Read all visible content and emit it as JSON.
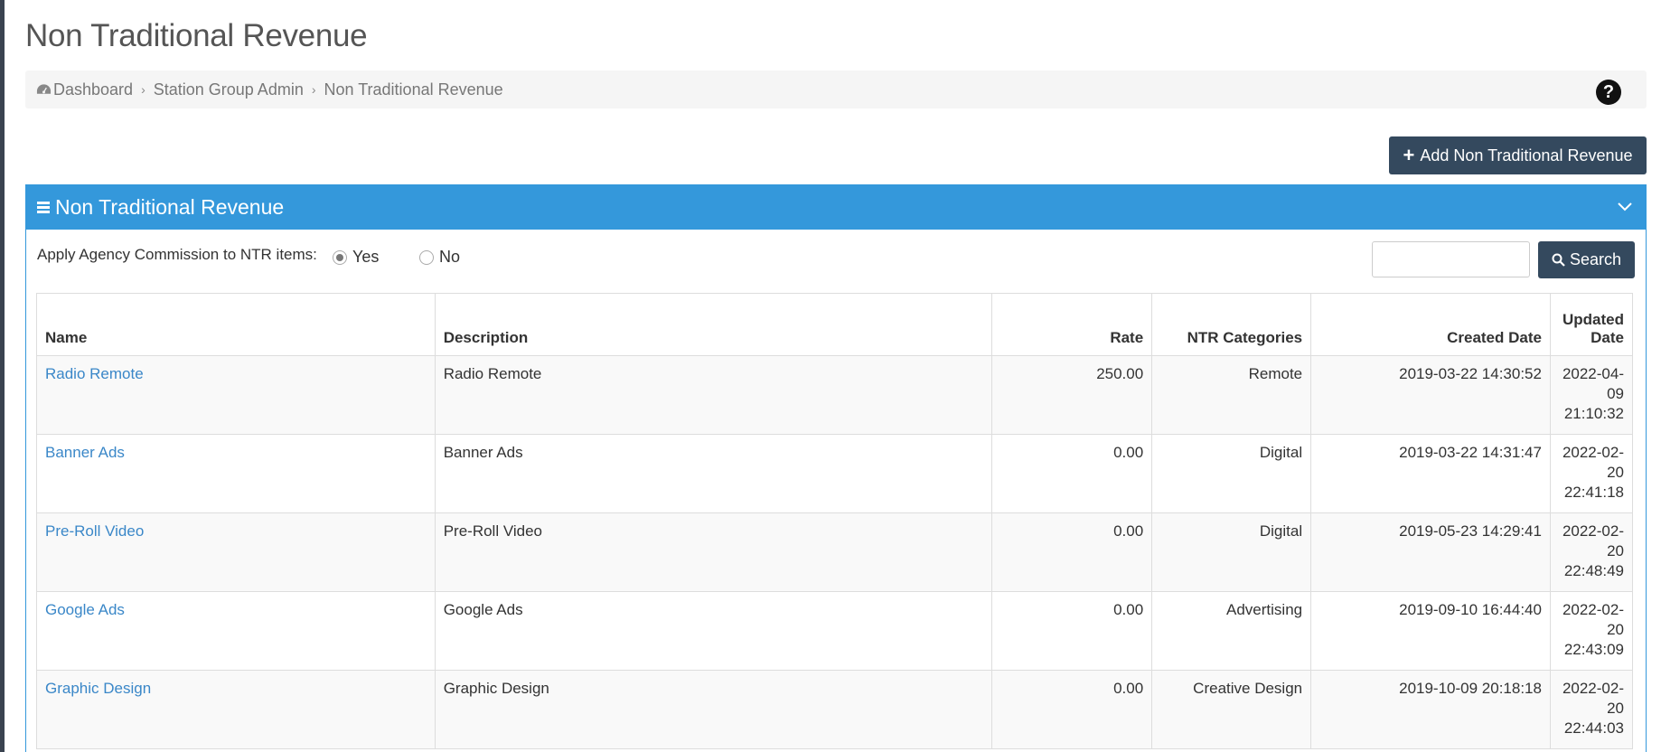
{
  "page": {
    "title": "Non Traditional Revenue"
  },
  "breadcrumb": {
    "items": [
      "Dashboard",
      "Station Group Admin",
      "Non Traditional Revenue"
    ]
  },
  "toolbar": {
    "add_label": "Add Non Traditional Revenue"
  },
  "panel": {
    "title": "Non Traditional Revenue",
    "commission_label": "Apply Agency Commission to NTR items:",
    "radio_yes": "Yes",
    "radio_no": "No",
    "selected": "Yes",
    "search_value": "",
    "search_label": "Search"
  },
  "table": {
    "headers": {
      "name": "Name",
      "description": "Description",
      "rate": "Rate",
      "categories": "NTR Categories",
      "created": "Created Date",
      "updated_1": "Updated",
      "updated_2": "Date"
    },
    "rows": [
      {
        "name": "Radio Remote",
        "description": "Radio Remote",
        "rate": "250.00",
        "category": "Remote",
        "created": "2019-03-22 14:30:52",
        "updated_a": "2022-04-",
        "updated_b": "09",
        "updated_c": "21:10:32"
      },
      {
        "name": "Banner Ads",
        "description": "Banner Ads",
        "rate": "0.00",
        "category": "Digital",
        "created": "2019-03-22 14:31:47",
        "updated_a": "2022-02-",
        "updated_b": "20",
        "updated_c": "22:41:18"
      },
      {
        "name": "Pre-Roll Video",
        "description": "Pre-Roll Video",
        "rate": "0.00",
        "category": "Digital",
        "created": "2019-05-23 14:29:41",
        "updated_a": "2022-02-",
        "updated_b": "20",
        "updated_c": "22:48:49"
      },
      {
        "name": "Google Ads",
        "description": "Google Ads",
        "rate": "0.00",
        "category": "Advertising",
        "created": "2019-09-10 16:44:40",
        "updated_a": "2022-02-",
        "updated_b": "20",
        "updated_c": "22:43:09"
      },
      {
        "name": "Graphic Design",
        "description": "Graphic Design",
        "rate": "0.00",
        "category": "Creative Design",
        "created": "2019-10-09 20:18:18",
        "updated_a": "2022-02-",
        "updated_b": "20",
        "updated_c": "22:44:03"
      }
    ]
  },
  "colors": {
    "accent": "#3498db",
    "dark_button": "#34495e",
    "link": "#3a87c8"
  },
  "icons": [
    "dashboard-icon",
    "chevron-right-icon",
    "help-icon",
    "plus-icon",
    "bars-icon",
    "chevron-down-icon",
    "search-icon"
  ]
}
